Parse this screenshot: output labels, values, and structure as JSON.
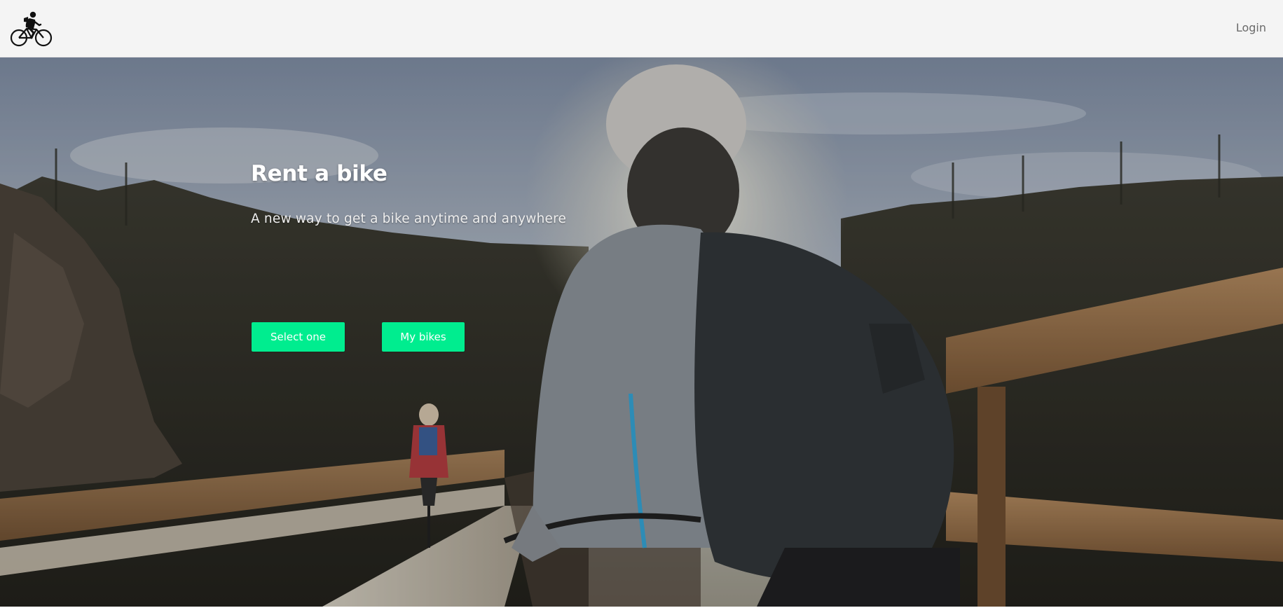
{
  "navbar": {
    "logo_icon": "bicycle-rider-icon",
    "login_label": "Login"
  },
  "hero": {
    "background": "photo-cyclists-on-wooden-bridge-sunlit-forest",
    "title": "Rent a bike",
    "subtitle": "A new way to get a bike anytime and anywhere",
    "buttons": {
      "select_label": "Select one",
      "my_bikes_label": "My bikes"
    }
  },
  "colors": {
    "accent": "#00ed8f",
    "navbar_bg": "#f4f4f4",
    "login_text": "#6a6a6a"
  }
}
